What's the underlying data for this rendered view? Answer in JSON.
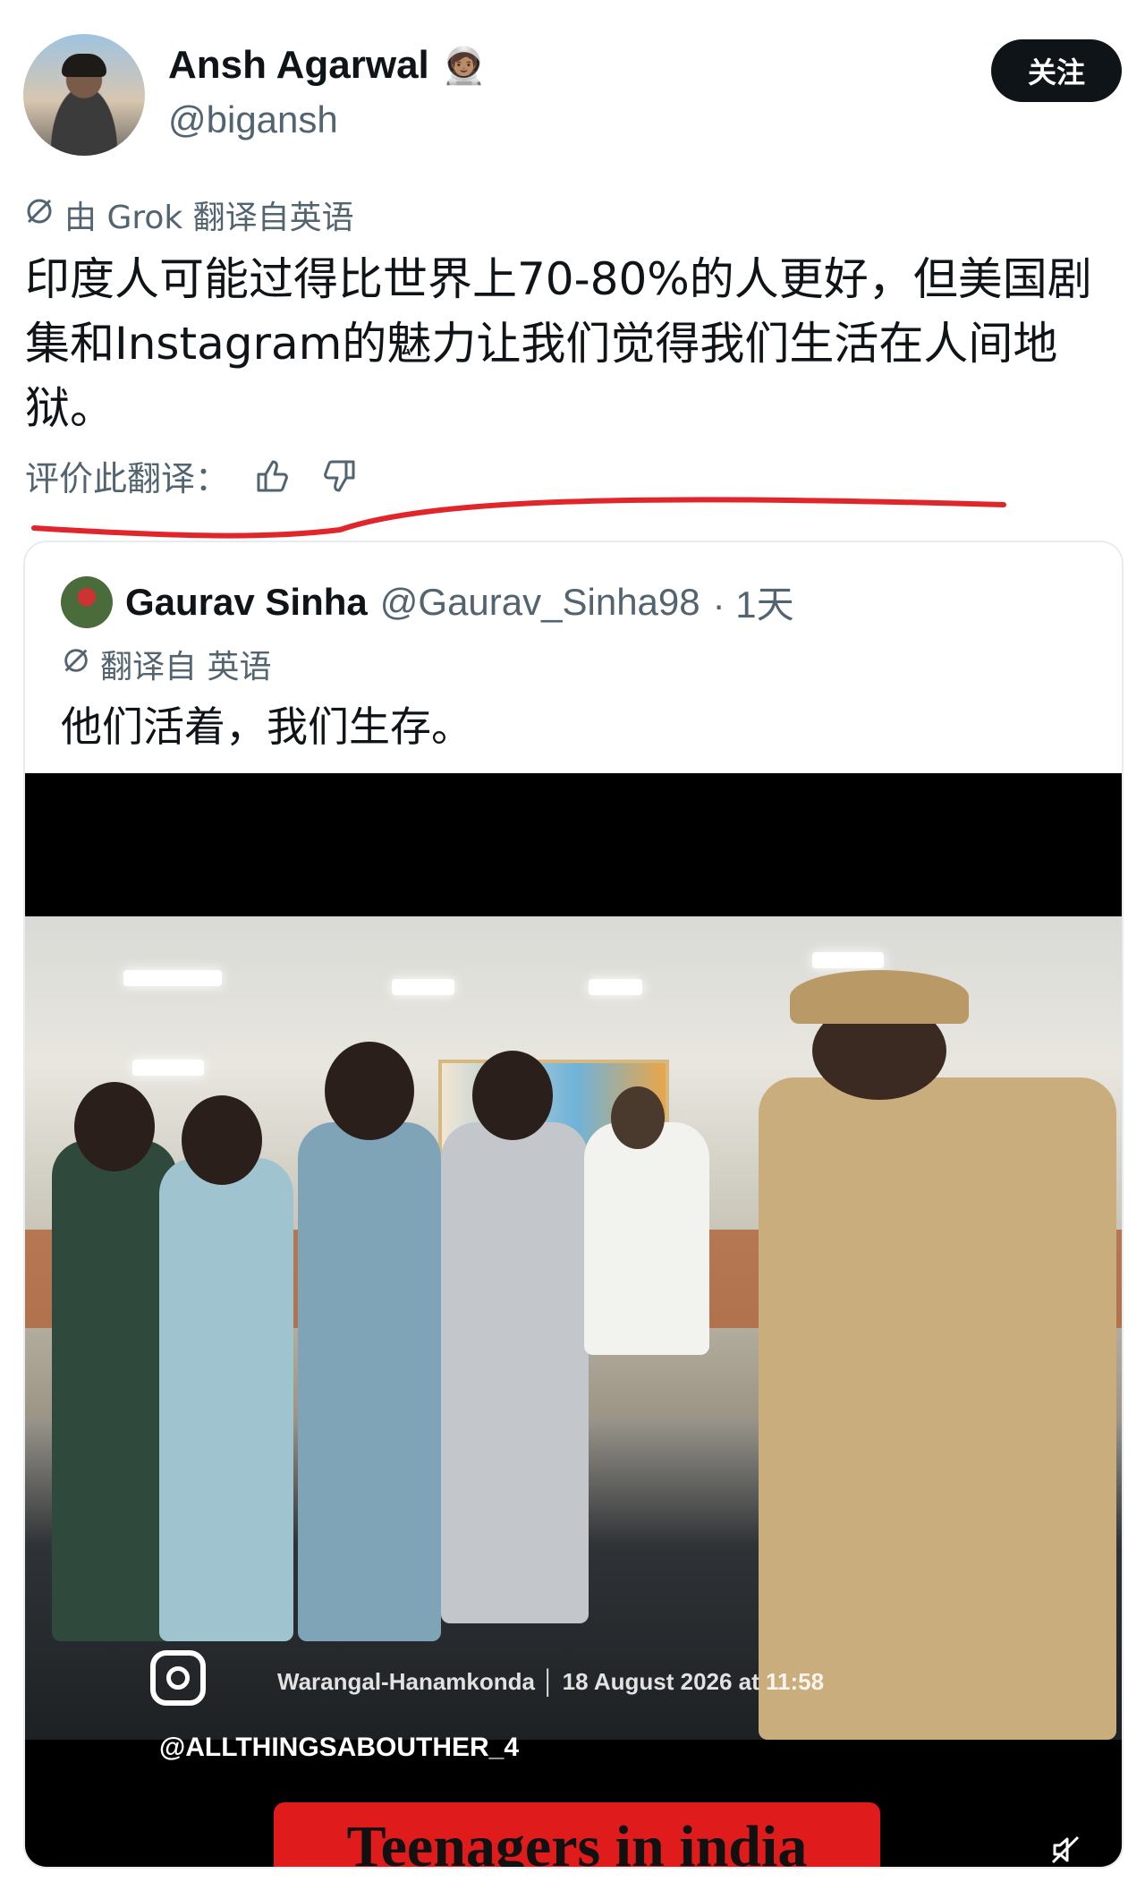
{
  "author": {
    "name": "Ansh Agarwal",
    "emoji": "🧑🏽‍🚀",
    "handle": "@bigansh",
    "follow_label": "关注"
  },
  "post": {
    "translated_by": "由 Grok 翻译自英语",
    "text": "印度人可能过得比世界上70-80%的人更好，但美国剧集和Instagram的魅力让我们觉得我们生活在人间地狱。",
    "rate_label": "评价此翻译："
  },
  "quoted": {
    "name": "Gaurav Sinha",
    "handle": "@Gaurav_Sinha98",
    "time": "· 1天",
    "translated_label": "翻译自 英语",
    "text": "他们活着，我们生存。",
    "media": {
      "caption": "Warangal-Hanamkonda │ 18 August 2026 at 11:58",
      "watermark": "@ALLTHINGSABOUTHER_4",
      "banner_text": "Teenagers in india"
    }
  },
  "colors": {
    "text_primary": "#0f1419",
    "text_secondary": "#536471",
    "annotation_red": "#e0262a",
    "banner_red": "#e01b1b"
  },
  "icons": [
    "translate-icon",
    "thumbs-up-icon",
    "thumbs-down-icon",
    "instagram-icon",
    "mute-icon"
  ]
}
